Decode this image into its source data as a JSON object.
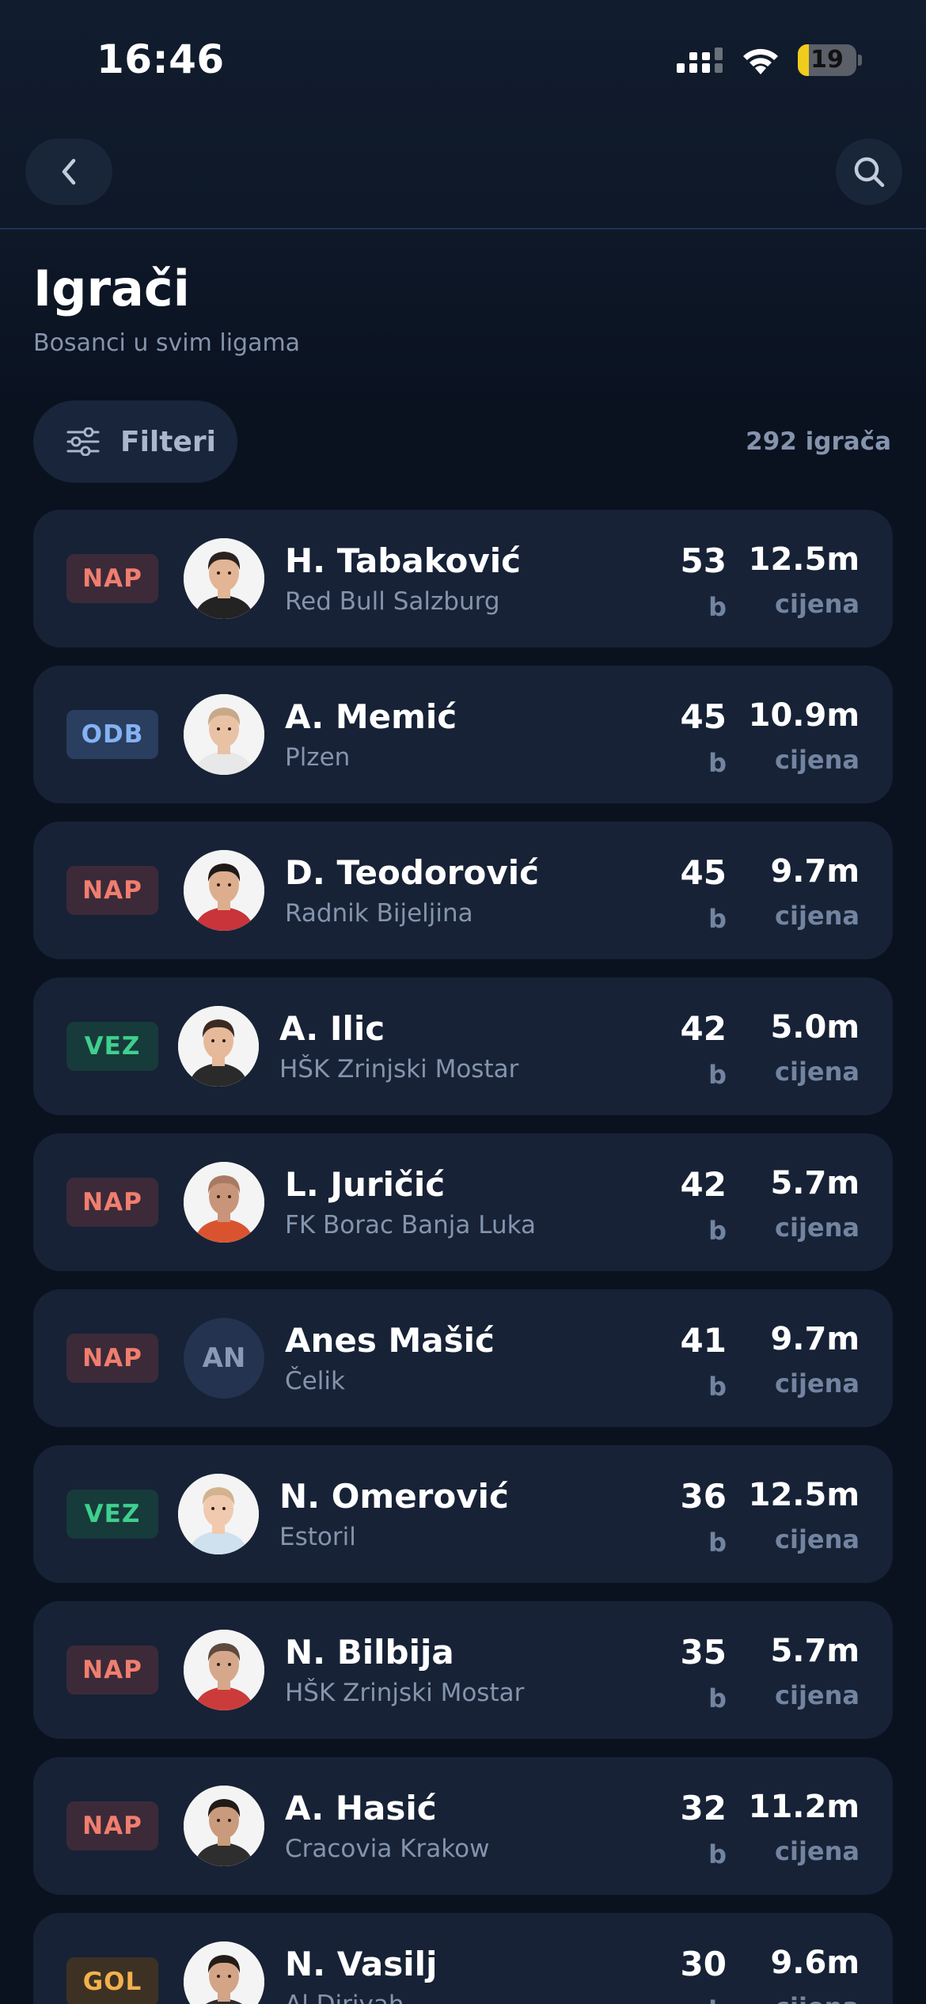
{
  "status_bar": {
    "time": "16:46",
    "battery": "19",
    "battery_level": 0.19
  },
  "nav": {
    "back_icon": "chevron-left-icon",
    "search_icon": "search-icon"
  },
  "header": {
    "title": "Igrači",
    "subtitle": "Bosanci u svim ligama"
  },
  "filter": {
    "label": "Filteri",
    "icon": "sliders-icon"
  },
  "player_count": "292 igrača",
  "colors": {
    "background": "#0a1220",
    "card": "#172236",
    "NAP": "#f07e6e",
    "ODB": "#84b2f3",
    "VEZ": "#3fcf8e",
    "GOL": "#f2b14d"
  },
  "players": [
    {
      "position": "NAP",
      "name": "H. Tabaković",
      "club": "Red Bull Salzburg",
      "points": "53",
      "points_unit": "b",
      "price": "12.5m",
      "price_unit": "cijena",
      "avatar": "photo",
      "skin": "#e2b595",
      "hair": "#2b2320",
      "shirt": "#232323"
    },
    {
      "position": "ODB",
      "name": "A. Memić",
      "club": "Plzen",
      "points": "45",
      "points_unit": "b",
      "price": "10.9m",
      "price_unit": "cijena",
      "avatar": "photo",
      "skin": "#e9c2a6",
      "hair": "#c7a98a",
      "shirt": "#e8e8e8"
    },
    {
      "position": "NAP",
      "name": "D. Teodorović",
      "club": "Radnik Bijeljina",
      "points": "45",
      "points_unit": "b",
      "price": "9.7m",
      "price_unit": "cijena",
      "avatar": "photo",
      "skin": "#dcae8e",
      "hair": "#1f1a18",
      "shirt": "#c8343a"
    },
    {
      "position": "VEZ",
      "name": "A. Ilic",
      "club": "HŠK Zrinjski Mostar",
      "points": "42",
      "points_unit": "b",
      "price": "5.0m",
      "price_unit": "cijena",
      "avatar": "photo",
      "skin": "#e5b99a",
      "hair": "#3a2a22",
      "shirt": "#2a2a2a"
    },
    {
      "position": "NAP",
      "name": "L. Juričić",
      "club": "FK Borac Banja Luka",
      "points": "42",
      "points_unit": "b",
      "price": "5.7m",
      "price_unit": "cijena",
      "avatar": "photo",
      "skin": "#c9957a",
      "hair": "#a77a63",
      "shirt": "#d9542e"
    },
    {
      "position": "NAP",
      "name": "Anes Mašić",
      "club": "Čelik",
      "points": "41",
      "points_unit": "b",
      "price": "9.7m",
      "price_unit": "cijena",
      "avatar": "initials",
      "initials": "AN"
    },
    {
      "position": "VEZ",
      "name": "N. Omerović",
      "club": "Estoril",
      "points": "36",
      "points_unit": "b",
      "price": "12.5m",
      "price_unit": "cijena",
      "avatar": "photo",
      "skin": "#f0c9ae",
      "hair": "#d1b38e",
      "shirt": "#cfe1ef"
    },
    {
      "position": "NAP",
      "name": "N. Bilbija",
      "club": "HŠK Zrinjski Mostar",
      "points": "35",
      "points_unit": "b",
      "price": "5.7m",
      "price_unit": "cijena",
      "avatar": "photo",
      "skin": "#d6a88b",
      "hair": "#5e4a3c",
      "shirt": "#cc3b3b"
    },
    {
      "position": "NAP",
      "name": "A. Hasić",
      "club": "Cracovia Krakow",
      "points": "32",
      "points_unit": "b",
      "price": "11.2m",
      "price_unit": "cijena",
      "avatar": "photo",
      "skin": "#c99b7c",
      "hair": "#231b17",
      "shirt": "#2e2e2e"
    },
    {
      "position": "GOL",
      "name": "N. Vasilj",
      "club": "Al Diriyah",
      "points": "30",
      "points_unit": "b",
      "price": "9.6m",
      "price_unit": "cijena",
      "avatar": "photo",
      "skin": "#d3a486",
      "hair": "#241c18",
      "shirt": "#2d2d2d"
    }
  ]
}
